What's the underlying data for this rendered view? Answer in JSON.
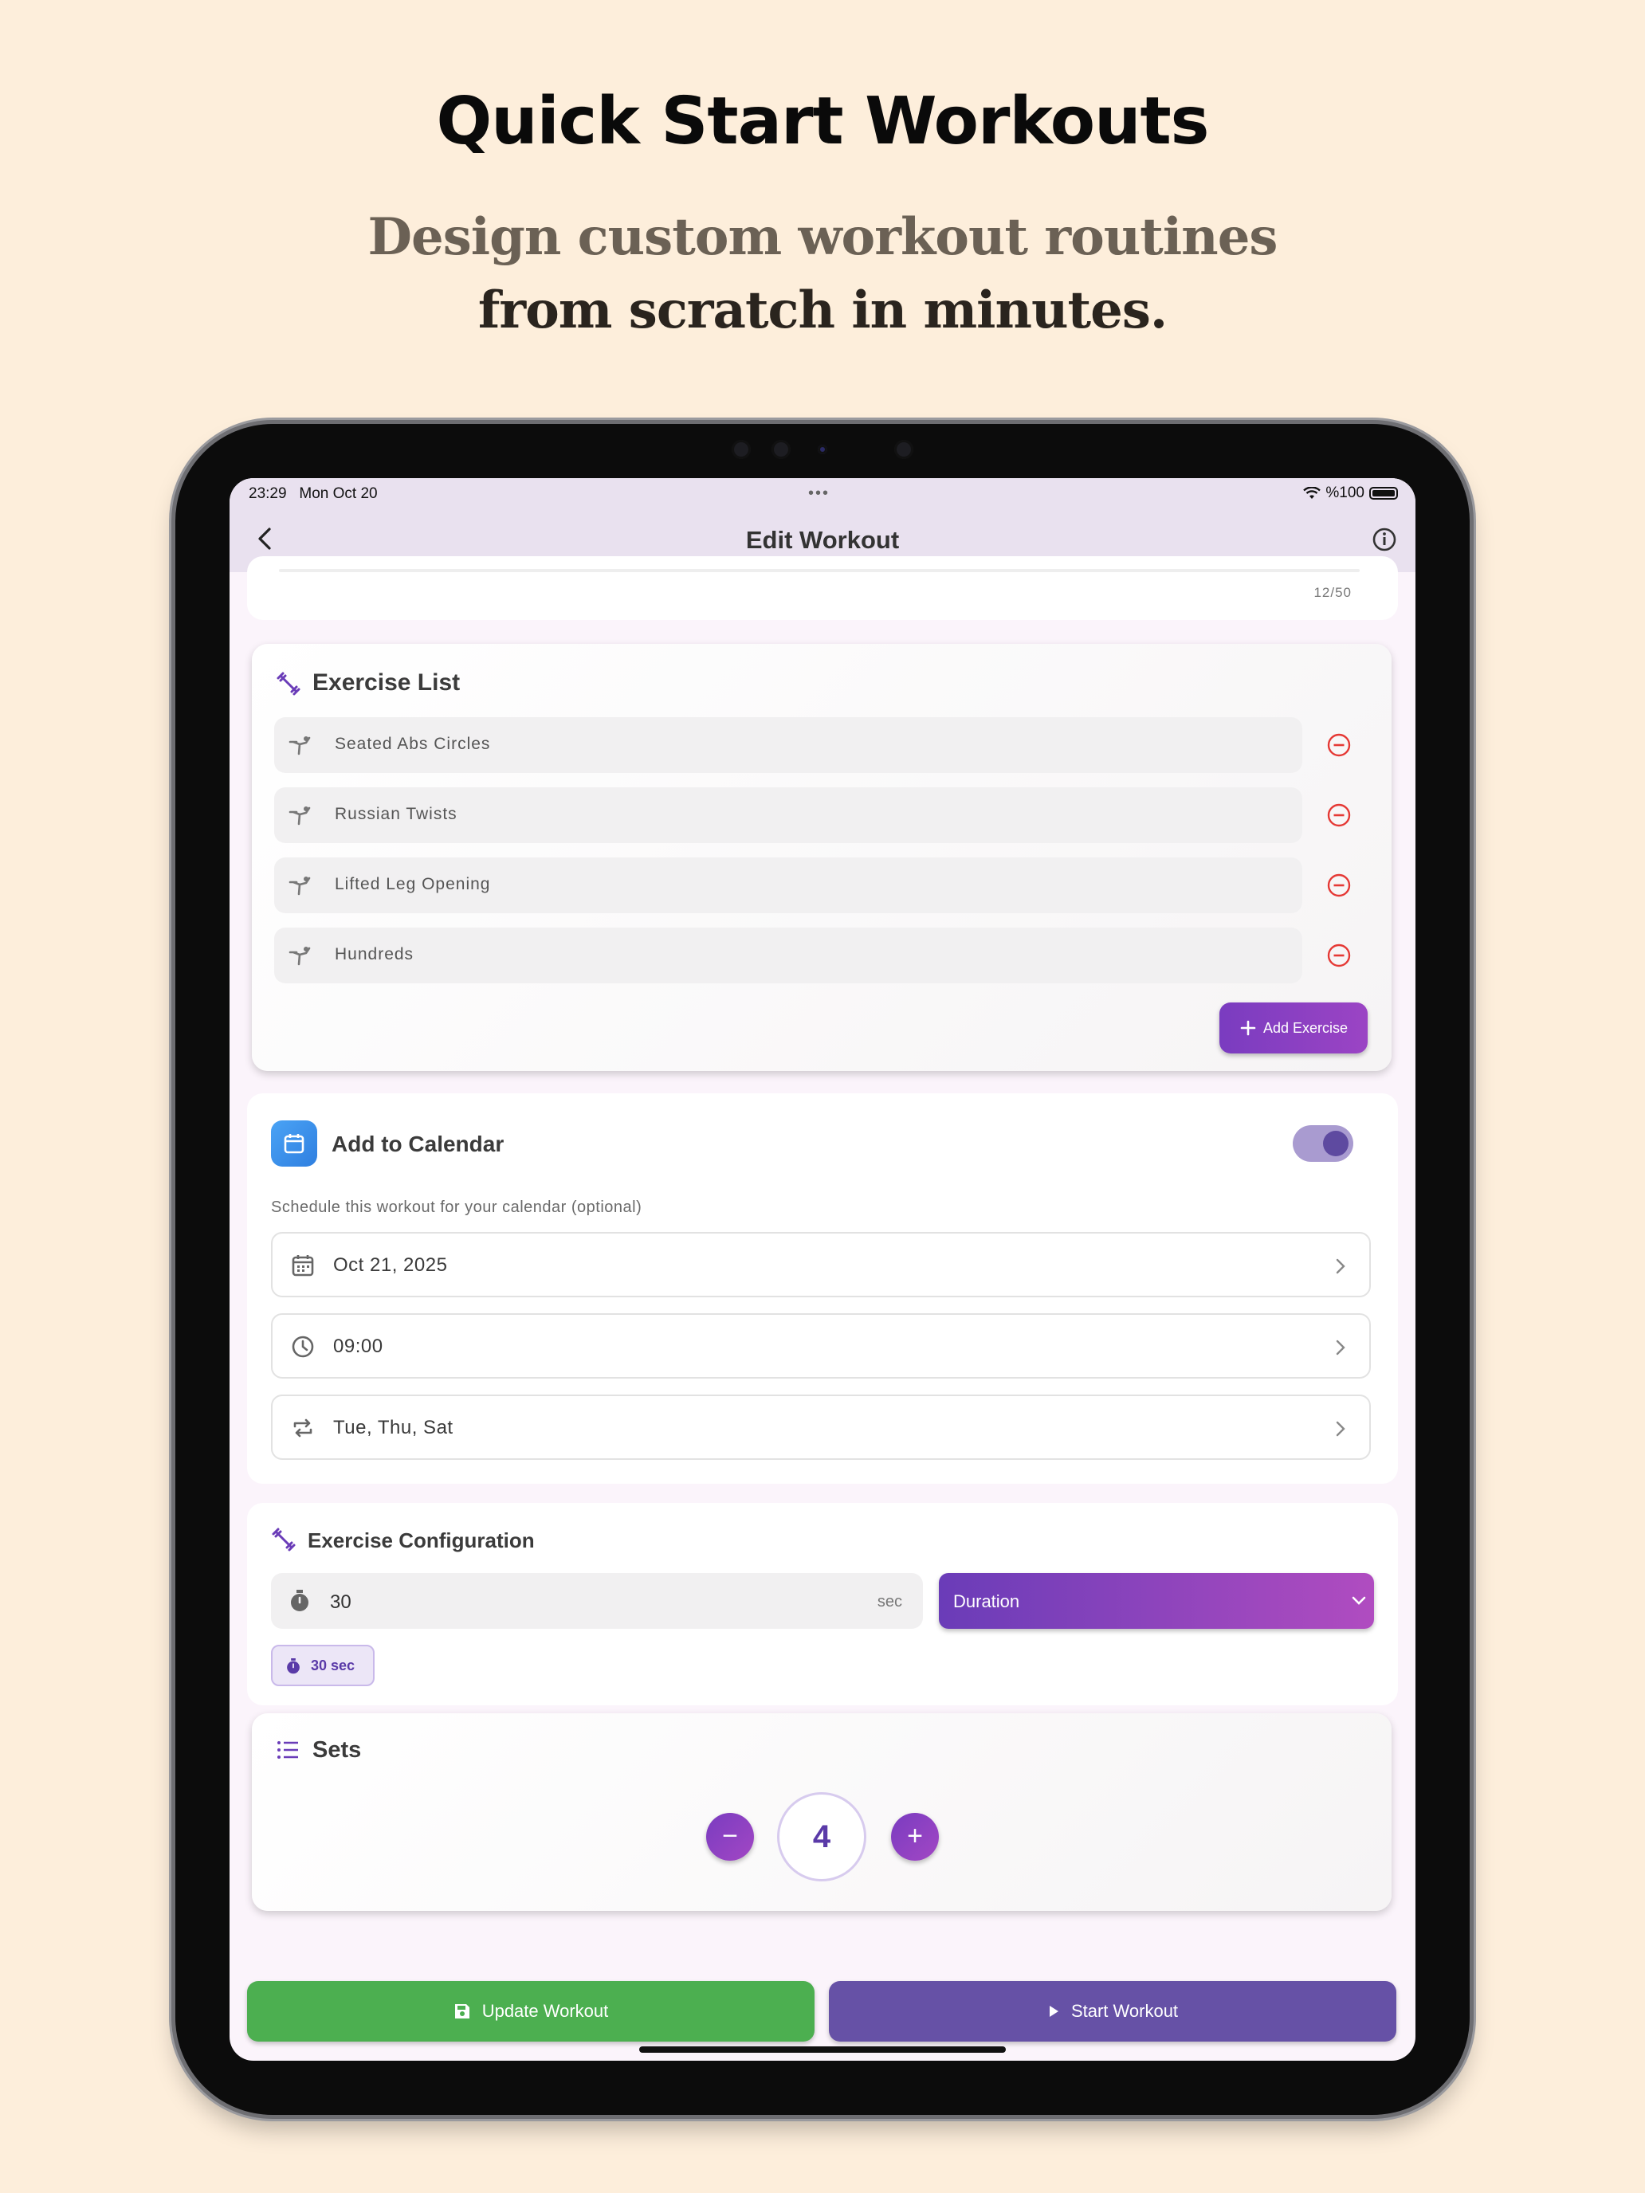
{
  "marketing": {
    "headline": "Quick Start Workouts",
    "subhead_line1": "Design custom workout routines",
    "subhead_line2": "from scratch in minutes."
  },
  "status_bar": {
    "time": "23:29",
    "date": "Mon Oct 20",
    "battery": "%100"
  },
  "app_bar": {
    "title": "Edit Workout",
    "back_icon": "chevron-left-icon",
    "info_icon": "info-circle-icon"
  },
  "name_card": {
    "char_counter": "12/50"
  },
  "exercise_list": {
    "title": "Exercise List",
    "icon": "dumbbell-icon",
    "items": [
      {
        "label": "Seated Abs Circles"
      },
      {
        "label": "Russian Twists"
      },
      {
        "label": "Lifted Leg Opening"
      },
      {
        "label": "Hundreds"
      }
    ],
    "add_button": "Add Exercise"
  },
  "calendar": {
    "title": "Add to Calendar",
    "toggle_on": true,
    "description": "Schedule this workout for your calendar (optional)",
    "date": "Oct 21, 2025",
    "time": "09:00",
    "repeat": "Tue, Thu, Sat"
  },
  "exercise_config": {
    "title": "Exercise Configuration",
    "value": "30",
    "unit": "sec",
    "mode": "Duration",
    "chip": "30 sec"
  },
  "sets": {
    "title": "Sets",
    "count": "4",
    "minus": "−",
    "plus": "+"
  },
  "actions": {
    "update": "Update Workout",
    "start": "Start Workout"
  },
  "colors": {
    "background": "#fdeedb",
    "accent_purple": "#7a3cc0",
    "update_green": "#4caf50",
    "start_purple": "#6651a6",
    "remove_red": "#e53935"
  }
}
